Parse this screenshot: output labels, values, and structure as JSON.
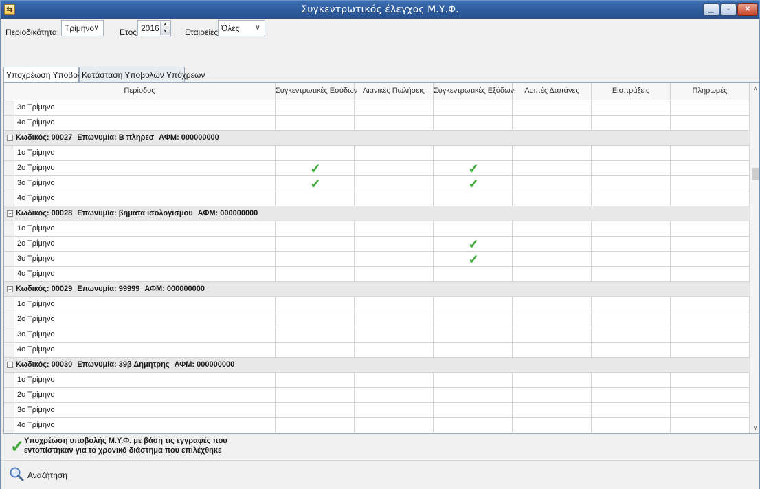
{
  "window": {
    "title": "Συγκεντρωτικός έλεγχος Μ.Υ.Φ."
  },
  "filters": {
    "period_label": "Περιοδικότητα",
    "period_value": "Τρίμηνο",
    "year_label": "Ετος",
    "year_value": "2016",
    "company_label": "Εταιρείες",
    "company_value": "Όλες"
  },
  "tabs": [
    {
      "label": "Υποχρέωση Υποβολής",
      "active": true
    },
    {
      "label": "Κατάσταση Υποβολών Υπόχρεων",
      "active": false
    }
  ],
  "grid": {
    "columns": [
      "Περίοδος",
      "Συγκεντρωτικές Εσόδων",
      "Λιανικές Πωλήσεις",
      "Συγκεντρωτικές Εξόδων",
      "Λοιπές Δαπάνες",
      "Εισπράξεις",
      "Πληρωμές"
    ],
    "leading_rows": [
      {
        "period": "3ο Τρίμηνο",
        "checks": [
          false,
          false,
          false,
          false,
          false,
          false
        ]
      },
      {
        "period": "4ο Τρίμηνο",
        "checks": [
          false,
          false,
          false,
          false,
          false,
          false
        ]
      }
    ],
    "groups": [
      {
        "code_label": "Κωδικός: 00027",
        "name_label": "Επωνυμία: Β πληρεσ",
        "afm_label": "ΑΦΜ: 000000000",
        "rows": [
          {
            "period": "1ο Τρίμηνο",
            "checks": [
              false,
              false,
              false,
              false,
              false,
              false
            ]
          },
          {
            "period": "2ο Τρίμηνο",
            "checks": [
              true,
              false,
              true,
              false,
              false,
              false
            ]
          },
          {
            "period": "3ο Τρίμηνο",
            "checks": [
              true,
              false,
              true,
              false,
              false,
              false
            ]
          },
          {
            "period": "4ο Τρίμηνο",
            "checks": [
              false,
              false,
              false,
              false,
              false,
              false
            ]
          }
        ]
      },
      {
        "code_label": "Κωδικός: 00028",
        "name_label": "Επωνυμία: βηματα ισολογισμου",
        "afm_label": "ΑΦΜ: 000000000",
        "rows": [
          {
            "period": "1ο Τρίμηνο",
            "checks": [
              false,
              false,
              false,
              false,
              false,
              false
            ]
          },
          {
            "period": "2ο Τρίμηνο",
            "checks": [
              false,
              false,
              true,
              false,
              false,
              false
            ]
          },
          {
            "period": "3ο Τρίμηνο",
            "checks": [
              false,
              false,
              true,
              false,
              false,
              false
            ]
          },
          {
            "period": "4ο Τρίμηνο",
            "checks": [
              false,
              false,
              false,
              false,
              false,
              false
            ]
          }
        ]
      },
      {
        "code_label": "Κωδικός: 00029",
        "name_label": "Επωνυμία: 99999",
        "afm_label": "ΑΦΜ: 000000000",
        "rows": [
          {
            "period": "1ο Τρίμηνο",
            "checks": [
              false,
              false,
              false,
              false,
              false,
              false
            ]
          },
          {
            "period": "2ο Τρίμηνο",
            "checks": [
              false,
              false,
              false,
              false,
              false,
              false
            ]
          },
          {
            "period": "3ο Τρίμηνο",
            "checks": [
              false,
              false,
              false,
              false,
              false,
              false
            ]
          },
          {
            "period": "4ο Τρίμηνο",
            "checks": [
              false,
              false,
              false,
              false,
              false,
              false
            ]
          }
        ]
      },
      {
        "code_label": "Κωδικός: 00030",
        "name_label": "Επωνυμία: 39β Δημητρης",
        "afm_label": "ΑΦΜ: 000000000",
        "rows": [
          {
            "period": "1ο Τρίμηνο",
            "checks": [
              false,
              false,
              false,
              false,
              false,
              false
            ]
          },
          {
            "period": "2ο Τρίμηνο",
            "checks": [
              false,
              false,
              false,
              false,
              false,
              false
            ]
          },
          {
            "period": "3ο Τρίμηνο",
            "checks": [
              false,
              false,
              false,
              false,
              false,
              false
            ]
          },
          {
            "period": "4ο Τρίμηνο",
            "checks": [
              false,
              false,
              false,
              false,
              false,
              false
            ]
          }
        ]
      }
    ]
  },
  "legend": {
    "icon": "check-icon",
    "text": "Υποχρέωση υποβολής Μ.Υ.Φ. με βάση τις εγγραφές που εντοπίστηκαν για το χρονικό διάστημα που επιλέχθηκε"
  },
  "footer": {
    "search_label": "Αναζήτηση",
    "search_icon": "magnifier-icon"
  },
  "colors": {
    "titlebar": "#2f5c9d",
    "check": "#3fa63a",
    "group_row": "#e8e8e8"
  }
}
